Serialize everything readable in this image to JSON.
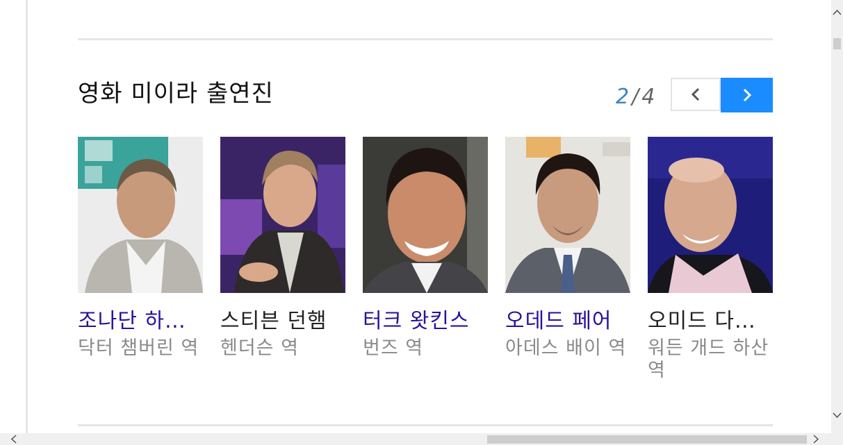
{
  "section": {
    "title": "영화 미이라 출연진",
    "pager": {
      "current": "2",
      "separator": "/",
      "total": "4"
    },
    "prev_icon": "chevron-left-icon",
    "next_icon": "chevron-right-icon",
    "next_button_color": "#1a8cff"
  },
  "cast": [
    {
      "name": "조나단 하…",
      "role": "닥터 챔버린 역",
      "style": "link"
    },
    {
      "name": "스티븐 던햄",
      "role": "헨더슨 역",
      "style": "plain"
    },
    {
      "name": "터크 왓킨스",
      "role": "번즈 역",
      "style": "link"
    },
    {
      "name": "오데드 페어",
      "role": "아데스 배이 역",
      "style": "link"
    },
    {
      "name": "오미드 다…",
      "role": "워든 개드 하산 역",
      "style": "plain"
    }
  ],
  "colors": {
    "link_name": "#26129a",
    "plain_name": "#222222",
    "role": "#8a8a8a",
    "pager_current": "#3b86c6"
  }
}
